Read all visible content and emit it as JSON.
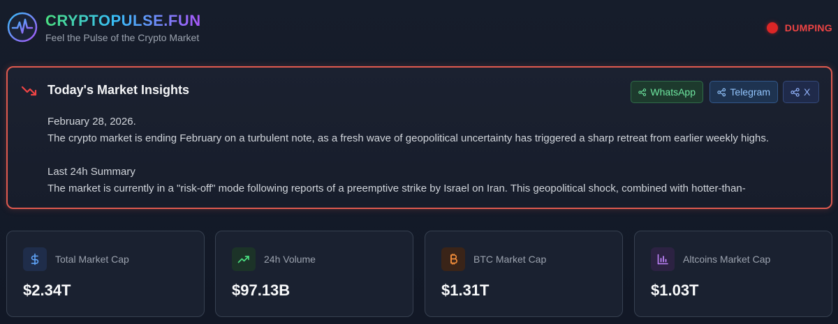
{
  "header": {
    "brand_name": "CRYPTOPULSE.FUN",
    "tagline": "Feel the Pulse of the Crypto Market",
    "market_status": "DUMPING",
    "market_status_color": "#dc2626"
  },
  "insights": {
    "title": "Today's Market Insights",
    "icon": "trend-down-icon",
    "share_buttons": [
      {
        "label": "WhatsApp",
        "icon": "share-icon"
      },
      {
        "label": "Telegram",
        "icon": "share-icon"
      },
      {
        "label": "X",
        "icon": "share-icon"
      }
    ],
    "date": "February 28, 2026.",
    "intro": "The crypto market is ending February on a turbulent note, as a fresh wave of geopolitical uncertainty has triggered a sharp retreat from earlier weekly highs.",
    "summary_heading": "Last 24h Summary",
    "summary_text": "The market is currently in a \"risk-off\" mode following reports of a preemptive strike by Israel on Iran. This geopolitical shock, combined with hotter-than-"
  },
  "stats": [
    {
      "label": "Total Market Cap",
      "value": "$2.34T",
      "icon": "dollar-icon"
    },
    {
      "label": "24h Volume",
      "value": "$97.13B",
      "icon": "trending-up-icon"
    },
    {
      "label": "BTC Market Cap",
      "value": "$1.31T",
      "icon": "bitcoin-icon"
    },
    {
      "label": "Altcoins Market Cap",
      "value": "$1.03T",
      "icon": "bar-chart-icon"
    }
  ]
}
